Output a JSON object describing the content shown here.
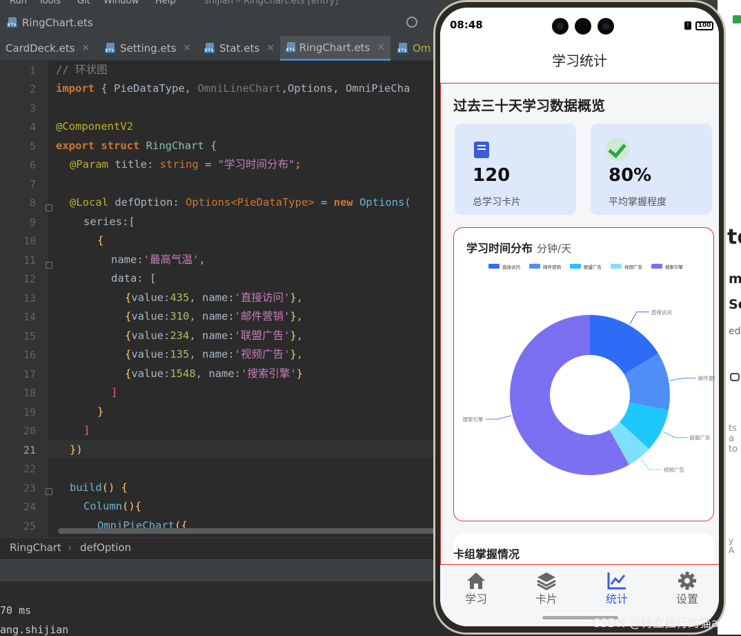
{
  "ide": {
    "menu": [
      "Run",
      "Tools",
      "Git",
      "Window",
      "Help"
    ],
    "project_info": "shijian – RingChart.ets [entry]",
    "current_file": "RingChart.ets",
    "tabs": [
      {
        "label": "CardDeck.ets"
      },
      {
        "label": "Setting.ets"
      },
      {
        "label": "Stat.ets"
      },
      {
        "label": "RingChart.ets"
      },
      {
        "label": "Om"
      }
    ],
    "line_numbers": [
      "1",
      "2",
      "3",
      "4",
      "5",
      "6",
      "7",
      "8",
      "9",
      "10",
      "11",
      "12",
      "13",
      "14",
      "15",
      "16",
      "17",
      "18",
      "19",
      "20",
      "21",
      "22",
      "23",
      "24",
      "25"
    ],
    "breadcrumb": [
      "RingChart",
      "defOption"
    ],
    "console_line1": "70 ms",
    "console_line2": "ang.shijian",
    "right_pane_chars": [
      "te",
      "m",
      "Se",
      "ed",
      "ts a",
      "to",
      "y A"
    ]
  },
  "code": {
    "line1": "// 环状图",
    "line2_kw": "import",
    "line2_rest": " { PieDataType, ",
    "line2_dim": "OmniLineChart",
    "line2_rest2": ",Options, OmniPieCha",
    "line4": "@ComponentV2",
    "line5_kw": "export struct",
    "line5_name": " RingChart",
    "line5_rest": " {",
    "line6_dec": "@Param",
    "line6_name": " title",
    "line6_colon": ": ",
    "line6_type": "string",
    "line6_eq": " = ",
    "line6_str": "\"学习时间分布\"",
    "line6_end": ";",
    "line8_dec": "@Local",
    "line8_name": " defOption",
    "line8_colon": ": ",
    "line8_type": "Options<PieDataType>",
    "line8_eq": " = ",
    "line8_new": "new",
    "line8_cls": " Options(",
    "line9": "series:[",
    "line10": "{",
    "line11_key": "name:",
    "line11_str": "'最高气温'",
    "line11_end": ",",
    "line12": "data: [",
    "data_rows": [
      {
        "value": "435",
        "name": "'直接访问'"
      },
      {
        "value": "310",
        "name": "'邮件营销'"
      },
      {
        "value": "234",
        "name": "'联盟广告'"
      },
      {
        "value": "135",
        "name": "'视频广告'"
      },
      {
        "value": "1548",
        "name": "'搜索引擎'"
      }
    ],
    "line18": "]",
    "line19": "}",
    "line20": "]",
    "line21": "})",
    "line23_fn": "build",
    "line23_rest": "() {",
    "line24_fn": "Column",
    "line24_rest": "(){",
    "line25_fn": "OmniPieChart",
    "line25_rest": "({"
  },
  "phone": {
    "time": "08:48",
    "battery": "100",
    "nav_title": "学习统计",
    "section_title": "过去三十天学习数据概览",
    "stats": [
      {
        "value": "120",
        "label": "总学习卡片",
        "icon": "book-icon"
      },
      {
        "value": "80%",
        "label": "平均掌握程度",
        "icon": "check-icon"
      }
    ],
    "chart_title": "学习时间分布",
    "chart_unit": "分钟/天",
    "deck_title": "卡组掌握情况",
    "bottom_nav": [
      {
        "label": "学习",
        "icon": "home-icon",
        "active": false
      },
      {
        "label": "卡片",
        "icon": "layers-icon",
        "active": false
      },
      {
        "label": "统计",
        "icon": "chart-icon",
        "active": true
      },
      {
        "label": "设置",
        "icon": "gear-icon",
        "active": false
      }
    ]
  },
  "watermark": "CSDN @特立独行的猫a",
  "colors": {
    "accent": "#3b5bdb",
    "border_red": "#e5322d",
    "stat_card_bg": "#dde8fb"
  },
  "chart_data": {
    "type": "pie",
    "variant": "ring",
    "categories": [
      "直接访问",
      "邮件营销",
      "联盟广告",
      "视频广告",
      "搜索引擎"
    ],
    "values": [
      435,
      310,
      234,
      135,
      1548
    ],
    "colors": [
      "#2f6cf6",
      "#4e8ef7",
      "#1ec8fc",
      "#7de0ff",
      "#7b6ff2"
    ],
    "legend": "top",
    "inner_radius_ratio": 0.5
  }
}
